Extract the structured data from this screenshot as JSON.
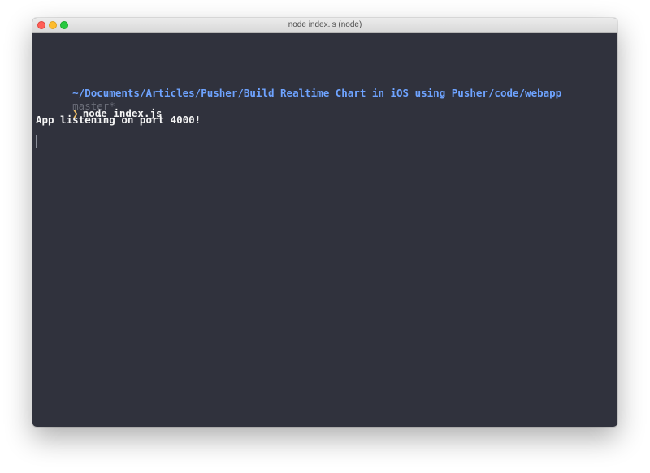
{
  "window": {
    "title": "node index.js (node)"
  },
  "terminal": {
    "cwd_path": "~/Documents/Articles/Pusher/Build Realtime Chart in iOS using Pusher/code/webapp",
    "git_branch": "master*",
    "prompt_symbol": "❯",
    "command": "node index.js",
    "output_line": "App listening on port 4000!"
  },
  "colors": {
    "terminal_bg": "#30323d",
    "path": "#6ea3ff",
    "branch": "#6a6d78",
    "prompt": "#f2c26a",
    "text": "#f4f4f4"
  }
}
